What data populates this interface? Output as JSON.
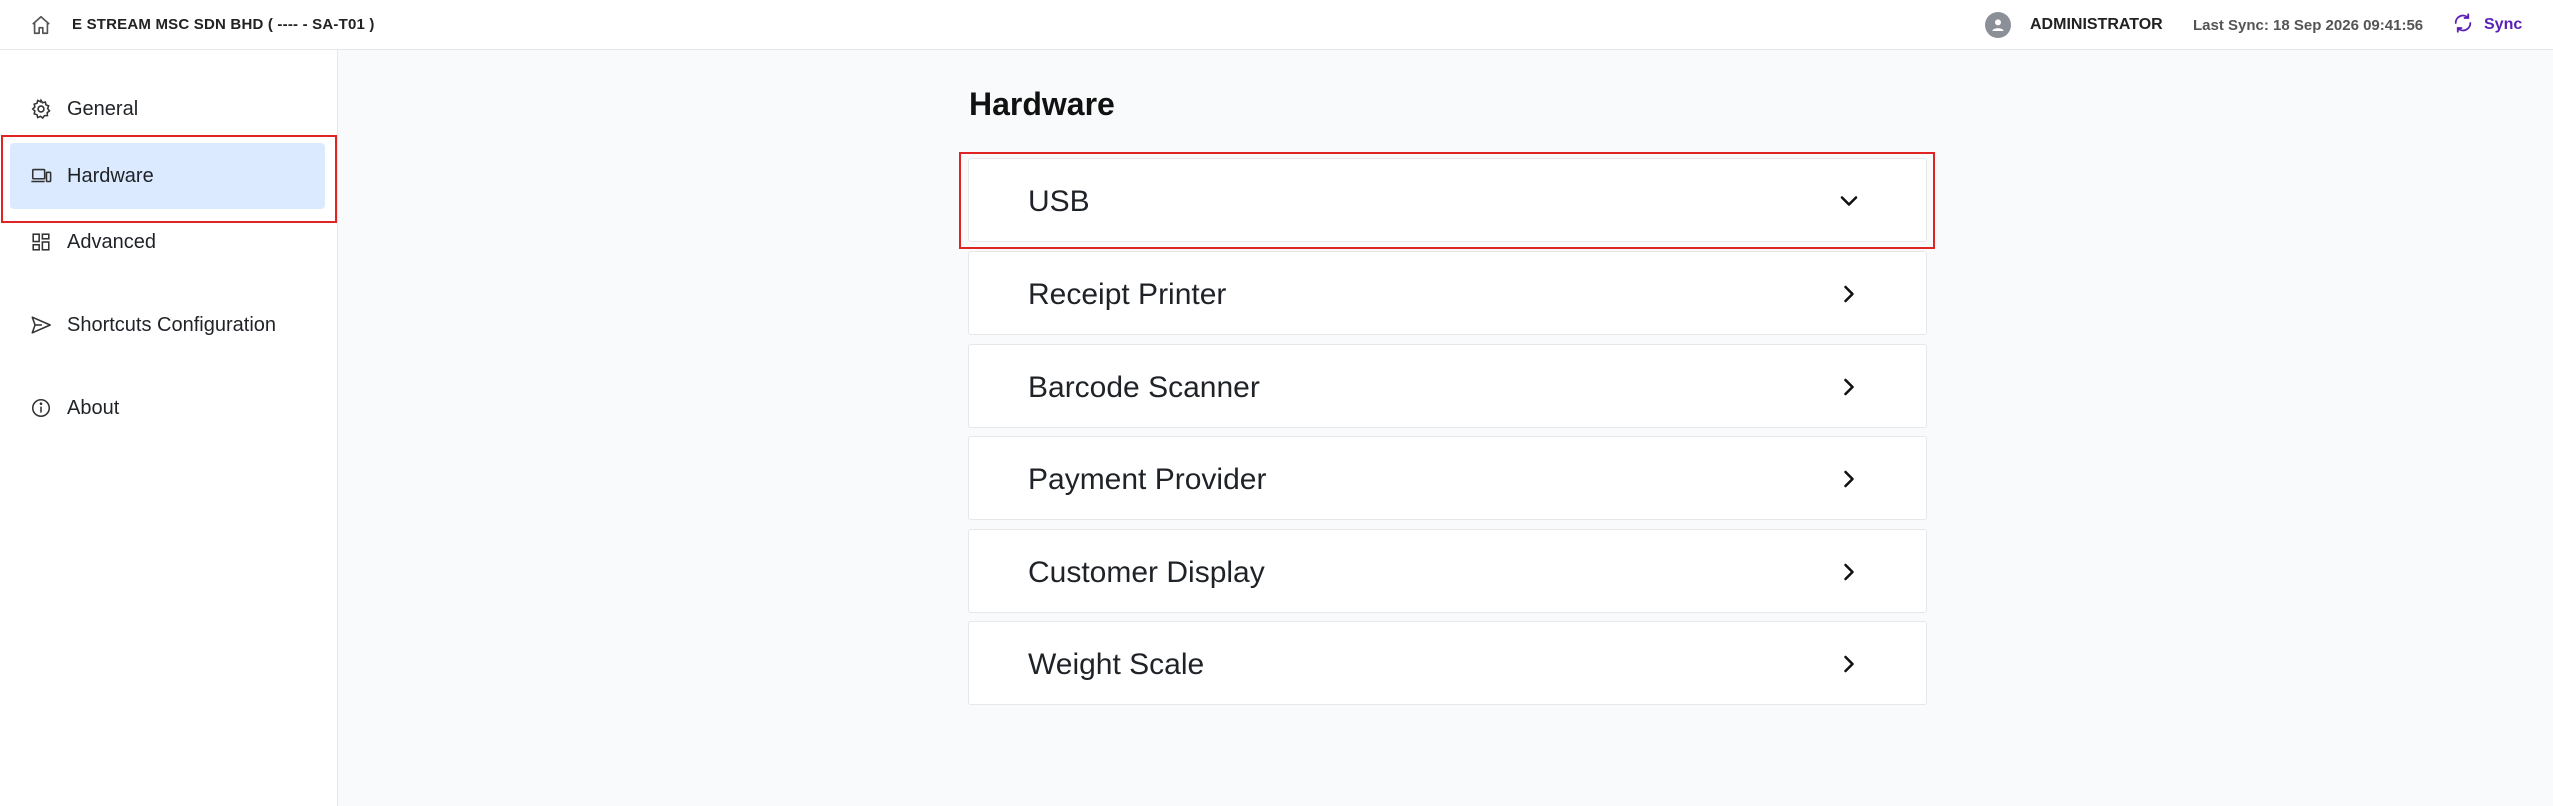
{
  "header": {
    "company": "E STREAM MSC SDN BHD ( ---- - SA-T01 )",
    "username": "ADMINISTRATOR",
    "last_sync": "Last Sync: 18 Sep 2026 09:41:56",
    "sync_label": "Sync",
    "accent_color": "#5b21b6"
  },
  "sidebar": {
    "items": [
      {
        "label": "General",
        "icon": "gear-icon"
      },
      {
        "label": "Hardware",
        "icon": "devices-icon",
        "active": true
      },
      {
        "label": "Advanced",
        "icon": "grid-icon"
      },
      {
        "label": "Shortcuts Configuration",
        "icon": "send-icon"
      },
      {
        "label": "About",
        "icon": "info-icon"
      }
    ]
  },
  "main": {
    "title": "Hardware",
    "sections": [
      {
        "label": "USB",
        "expanded": true
      },
      {
        "label": "Receipt Printer",
        "expanded": false
      },
      {
        "label": "Barcode Scanner",
        "expanded": false
      },
      {
        "label": "Payment Provider",
        "expanded": false
      },
      {
        "label": "Customer Display",
        "expanded": false
      },
      {
        "label": "Weight Scale",
        "expanded": false
      }
    ]
  }
}
